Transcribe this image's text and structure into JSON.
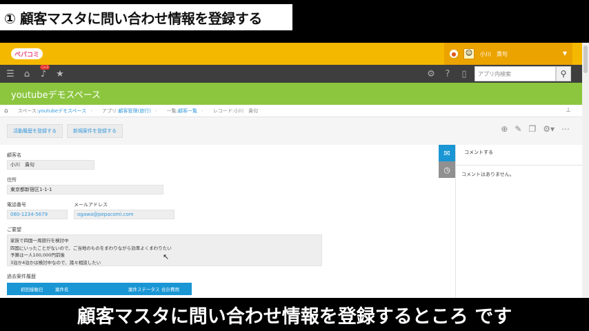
{
  "banner": {
    "text": "① 顧客マスタに問い合わせ情報を登録する"
  },
  "header": {
    "logo_text": "ペパコミ",
    "user_name": "小川　貴句",
    "bell_badge": "●"
  },
  "nav": {
    "notification_badge": "ﾆｭｰｽ",
    "search_placeholder": "アプリ内検索"
  },
  "space": {
    "title": "youtubeデモスペース"
  },
  "breadcrumb": {
    "items": [
      {
        "prefix": "スペース: ",
        "value": "youtubeデモスペース"
      },
      {
        "prefix": "アプリ: ",
        "value": "顧客管理(旅行)"
      },
      {
        "prefix": "一覧: ",
        "value": "顧客一覧"
      },
      {
        "prefix": "レコード: ",
        "value": "小川　貴句"
      }
    ]
  },
  "actions": {
    "add_activity": "活動履歴を登録する",
    "add_case": "新規案件を登録する"
  },
  "form": {
    "customer_name_label": "顧客名",
    "customer_name": "小川　貴句",
    "address_label": "住所",
    "address": "東京都新宿区1-1-1",
    "phone_label": "電話番号",
    "phone": "080-1234-5679",
    "email_label": "メールアドレス",
    "email": "ogawa@pepacomi.com",
    "request_label": "ご要望",
    "request_lines": [
      "家族で四国一周旅行を検討中",
      "四国にいったことがないので、ご当地のものをまわりながら効率よくまわりたい",
      "予算は一人100,000円前後",
      "3泊か4泊かは検討中なので、諸々相談したい"
    ],
    "history_label": "過去案件履歴",
    "history_columns": [
      "初回接触日",
      "案件名",
      "案件ステータス",
      "合計費用"
    ]
  },
  "comments": {
    "header": "コメントする",
    "empty": "コメントはありません。"
  },
  "caption": {
    "text": "顧客マスタに問い合わせ情報を登録するところ です"
  },
  "colors": {
    "header": "#f5b800",
    "nav": "#3e3e3e",
    "space_bar": "#8cc63f",
    "accent_blue": "#1a96d4"
  }
}
